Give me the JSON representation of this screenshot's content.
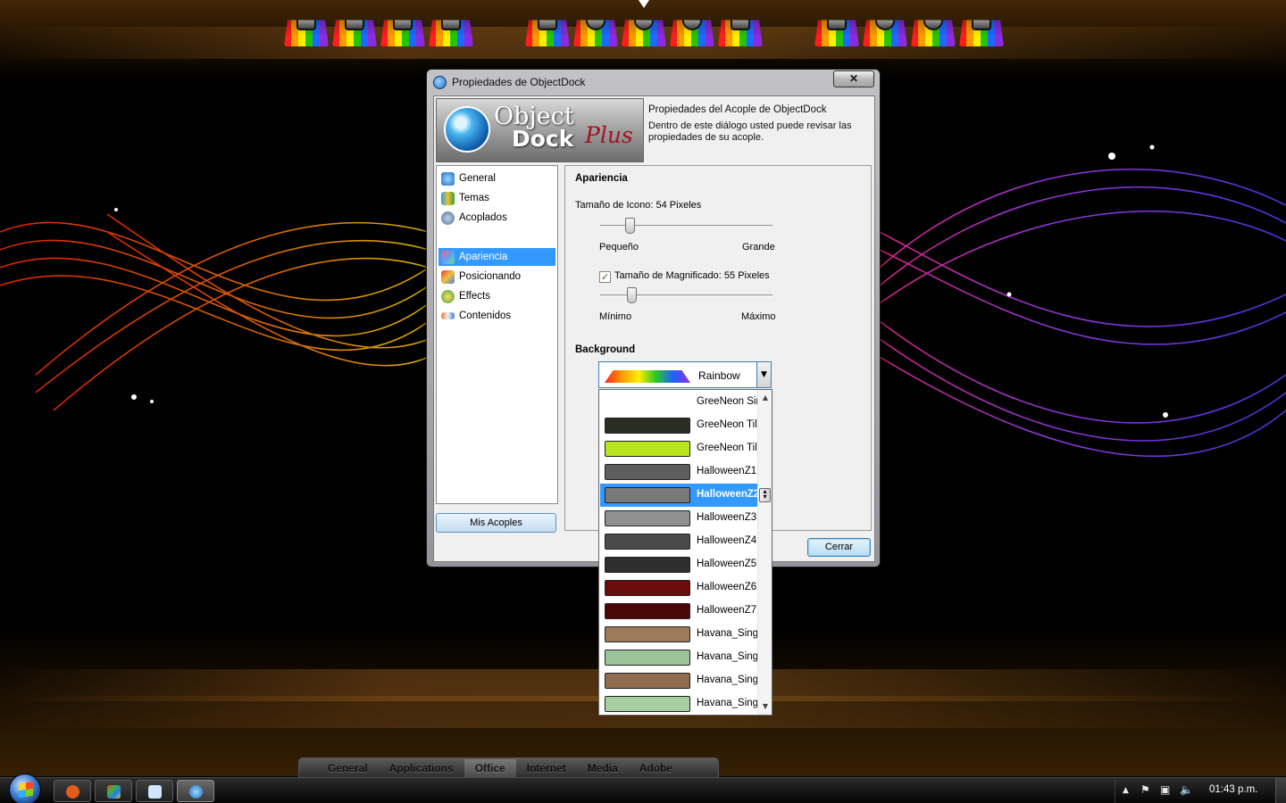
{
  "window": {
    "title": "Propiedades de ObjectDock",
    "close_label": "✕"
  },
  "banner": {
    "logo_object": "Object",
    "logo_dock": "Dock",
    "logo_plus": "Plus",
    "title": "Propiedades del Acople de ObjectDock",
    "description": "Dentro de este diálogo usted puede revisar las propiedades de su acople."
  },
  "nav": {
    "items": [
      {
        "label": "General",
        "icon": "dock-gear-icon"
      },
      {
        "label": "Temas",
        "icon": "themes-icon"
      },
      {
        "label": "Acoplados",
        "icon": "docked-gears-icon"
      },
      {
        "label": "Apariencia",
        "icon": "appearance-icon",
        "selected": true
      },
      {
        "label": "Posicionando",
        "icon": "positioning-tools-icon"
      },
      {
        "label": "Effects",
        "icon": "effects-icon"
      },
      {
        "label": "Contenidos",
        "icon": "contents-icon"
      }
    ],
    "mis_acoples_label": "Mis Acoples"
  },
  "apariencia": {
    "section_title": "Apariencia",
    "icon_size_label": "Tamaño de Icono: 54 Pixeles",
    "icon_size_min_label": "Pequeño",
    "icon_size_max_label": "Grande",
    "icon_size_fraction": 0.17,
    "magnify_checked": true,
    "magnify_label": "Tamaño de Magnificado: 55 Pixeles",
    "magnify_min_label": "Mínimo",
    "magnify_max_label": "Máximo",
    "magnify_fraction": 0.18,
    "background_title": "Background",
    "background_selected": "Rainbow"
  },
  "dropdown": {
    "options": [
      {
        "label": "GreeNeon Sin",
        "swatch": "#ffffff"
      },
      {
        "label": "GreeNeon Tile",
        "swatch": "#2a2e22"
      },
      {
        "label": "GreeNeon Tile",
        "swatch": "#b8e61c"
      },
      {
        "label": "HalloweenZ1",
        "swatch": "#5e5e5e"
      },
      {
        "label": "HalloweenZ2",
        "swatch": "#7a7a7a",
        "selected": true
      },
      {
        "label": "HalloweenZ3",
        "swatch": "#909090"
      },
      {
        "label": "HalloweenZ4",
        "swatch": "#4a4a4a"
      },
      {
        "label": "HalloweenZ5",
        "swatch": "#2e2e2e"
      },
      {
        "label": "HalloweenZ6",
        "swatch": "#6b0d0d"
      },
      {
        "label": "HalloweenZ7",
        "swatch": "#4a0707"
      },
      {
        "label": "Havana_Singl",
        "swatch": "#9c7a5a"
      },
      {
        "label": "Havana_Singl",
        "swatch": "#9cc49a"
      },
      {
        "label": "Havana_Singl",
        "swatch": "#8f6d4e"
      },
      {
        "label": "Havana_Singl",
        "swatch": "#a6d0a2"
      }
    ]
  },
  "buttons": {
    "cerrar_label": "Cerrar"
  },
  "bottom_dock": {
    "tabs": [
      "General",
      "Applications",
      "Office",
      "Internet",
      "Media",
      "Adobe"
    ],
    "active_tab": "Office"
  },
  "taskbar": {
    "clock": "01:43 p.m.",
    "tray_up": "▲",
    "tray_flag": "⚑",
    "tray_network": "▣",
    "tray_volume": "🔈",
    "apps": [
      {
        "name": "firefox-icon",
        "color": "#e25b1b"
      },
      {
        "name": "windows-explorer-icon",
        "color": "#f0a020"
      },
      {
        "name": "notepad-icon",
        "color": "#cfe4ff"
      },
      {
        "name": "objectdock-icon",
        "color": "#3a8ee0",
        "active": true
      }
    ]
  },
  "top_dock": {
    "groups": [
      [
        "folder-lock-icon",
        "folder-monitor-icon",
        "folder-music-icon",
        "folder-down-icon"
      ],
      [
        "users-icon",
        "ie-icon",
        "power-icon",
        "zero-icon",
        "network-icon"
      ],
      [
        "toolbox-icon",
        "share-icon",
        "hierarchy-icon",
        "briefcase-icon"
      ]
    ]
  }
}
